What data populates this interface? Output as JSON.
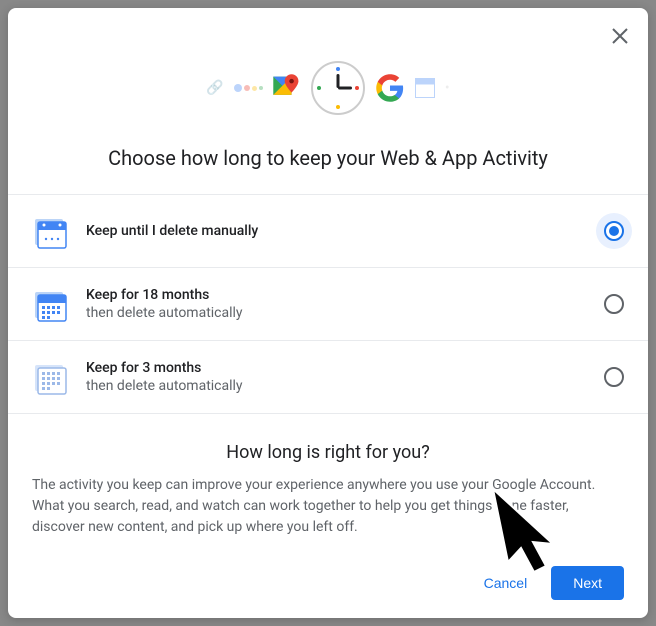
{
  "dialog": {
    "title": "Choose how long to keep your Web & App Activity",
    "options": [
      {
        "title": "Keep until I delete manually",
        "subtitle": "",
        "selected": true
      },
      {
        "title": "Keep for 18 months",
        "subtitle": "then delete automatically",
        "selected": false
      },
      {
        "title": "Keep for 3 months",
        "subtitle": "then delete automatically",
        "selected": false
      }
    ],
    "info": {
      "heading": "How long is right for you?",
      "body": "The activity you keep can improve your experience anywhere you use your Google Account. What you search, read, and watch can work together to help you get things done faster, discover new content, and pick up where you left off."
    },
    "buttons": {
      "cancel": "Cancel",
      "next": "Next"
    }
  }
}
